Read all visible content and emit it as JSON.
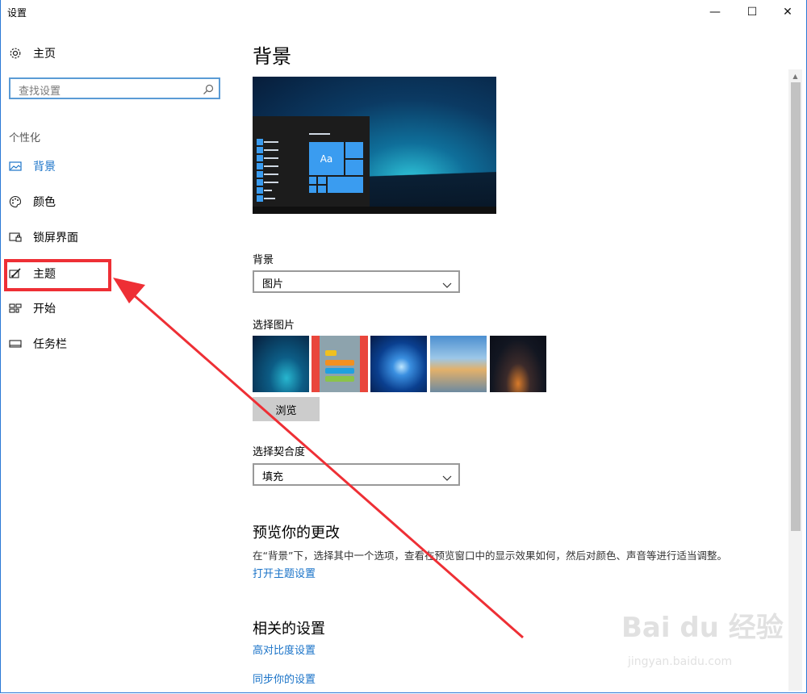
{
  "window": {
    "title": "设置",
    "minimize": "—",
    "maximize": "☐",
    "close": "✕"
  },
  "sidebar": {
    "home_label": "主页",
    "search_placeholder": "查找设置",
    "section_label": "个性化",
    "items": [
      {
        "label": "背景",
        "icon": "picture-icon",
        "active": true
      },
      {
        "label": "颜色",
        "icon": "palette-icon",
        "active": false
      },
      {
        "label": "锁屏界面",
        "icon": "lock-screen-icon",
        "active": false
      },
      {
        "label": "主题",
        "icon": "theme-brush-icon",
        "active": false
      },
      {
        "label": "开始",
        "icon": "start-tiles-icon",
        "active": false
      },
      {
        "label": "任务栏",
        "icon": "taskbar-icon",
        "active": false
      }
    ]
  },
  "main": {
    "page_title": "背景",
    "preview_tile_text": "Aa",
    "background_label": "背景",
    "background_value": "图片",
    "choose_picture_label": "选择图片",
    "browse_label": "浏览",
    "fit_label": "选择契合度",
    "fit_value": "填充",
    "preview_heading": "预览你的更改",
    "preview_desc": "在“背景”下，选择其中一个选项，查看在预览窗口中的显示效果如何，然后对颜色、声音等进行适当调整。",
    "open_theme_link": "打开主题设置",
    "related_heading": "相关的设置",
    "high_contrast_link": "高对比度设置",
    "sync_link": "同步你的设置"
  },
  "colors": {
    "accent": "#1a73c8",
    "annotation": "#ee2f35",
    "tile": "#3a9cf0"
  },
  "watermark": {
    "brand": "Bai du 经验",
    "url": "jingyan.baidu.com"
  }
}
